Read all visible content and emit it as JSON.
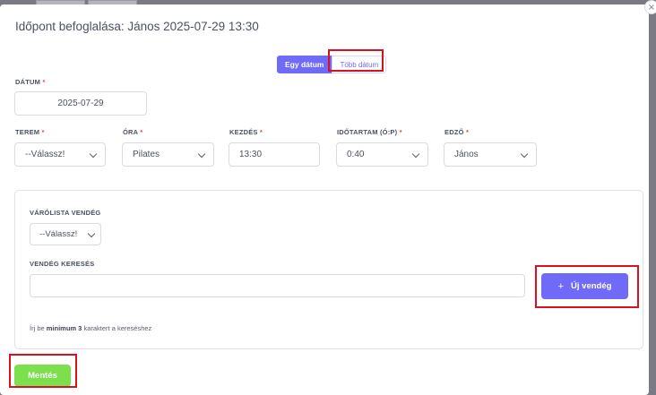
{
  "modal": {
    "title": "Időpont befoglalása: János 2025-07-29 13:30",
    "close_symbol": "×"
  },
  "mode_toggle": {
    "single_label": "Egy dátum",
    "multi_label": "Több dátum"
  },
  "date": {
    "label": "DÁTUM",
    "value": "2025-07-29"
  },
  "fields": {
    "room": {
      "label": "TEREM",
      "value": "--Válassz!"
    },
    "class": {
      "label": "ÓRA",
      "value": "Pilates"
    },
    "start": {
      "label": "KEZDÉS",
      "value": "13:30"
    },
    "duration": {
      "label": "IDŐTARTAM (Ó:P)",
      "value": "0:40"
    },
    "trainer": {
      "label": "EDZŐ",
      "value": "János"
    }
  },
  "required_mark": "*",
  "guest_card": {
    "waitlist_label": "VÁRÓLISTA VENDÉG",
    "waitlist_value": "--Válassz!",
    "search_label": "VENDÉG KERESÉS",
    "search_value": "",
    "new_guest_label": "Új vendég",
    "plus_symbol": "+",
    "hint_prefix": "Írj be ",
    "hint_bold": "minimum 3",
    "hint_suffix": " karaktert a kereséshez"
  },
  "save_label": "Mentés",
  "colors": {
    "accent": "#6f6af8",
    "save": "#7be04b",
    "highlight": "#d6131c",
    "required": "#e04848"
  }
}
